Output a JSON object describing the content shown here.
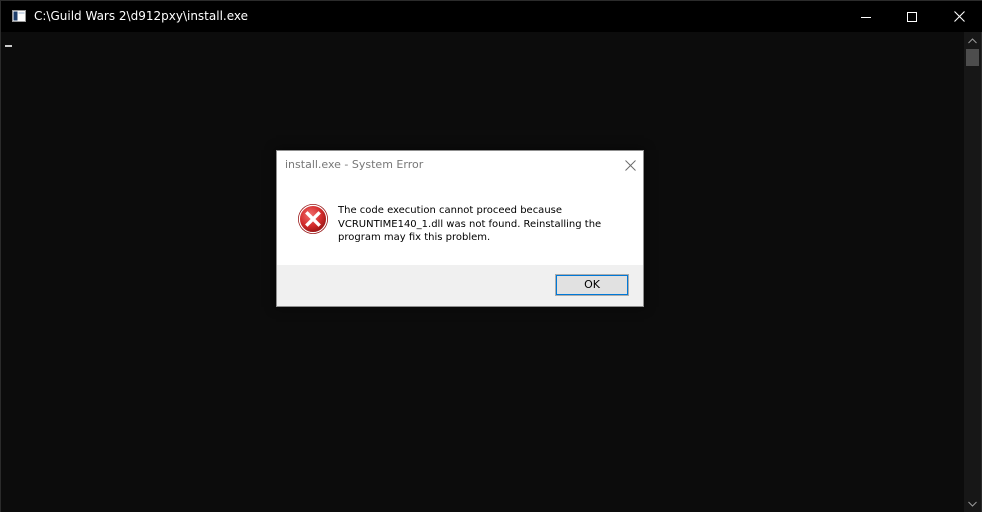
{
  "window": {
    "title": "C:\\Guild Wars 2\\d912pxy\\install.exe",
    "background_color": "#0c0c0c",
    "titlebar_color": "#000000",
    "icon": "console-app-icon",
    "controls": {
      "minimize_icon": "minimize-icon",
      "maximize_icon": "maximize-icon",
      "close_icon": "close-icon"
    }
  },
  "scrollbar": {
    "up_icon": "scroll-up-arrow-icon",
    "down_icon": "scroll-down-arrow-icon"
  },
  "dialog": {
    "title": "install.exe - System Error",
    "icon": "error-icon",
    "message_lines": [
      "The code execution cannot proceed because",
      "VCRUNTIME140_1.dll was not found. Reinstalling the",
      "program may fix this problem."
    ],
    "ok_label": "OK",
    "accent_color": "#0078d7",
    "error_color": "#c42b1c"
  }
}
